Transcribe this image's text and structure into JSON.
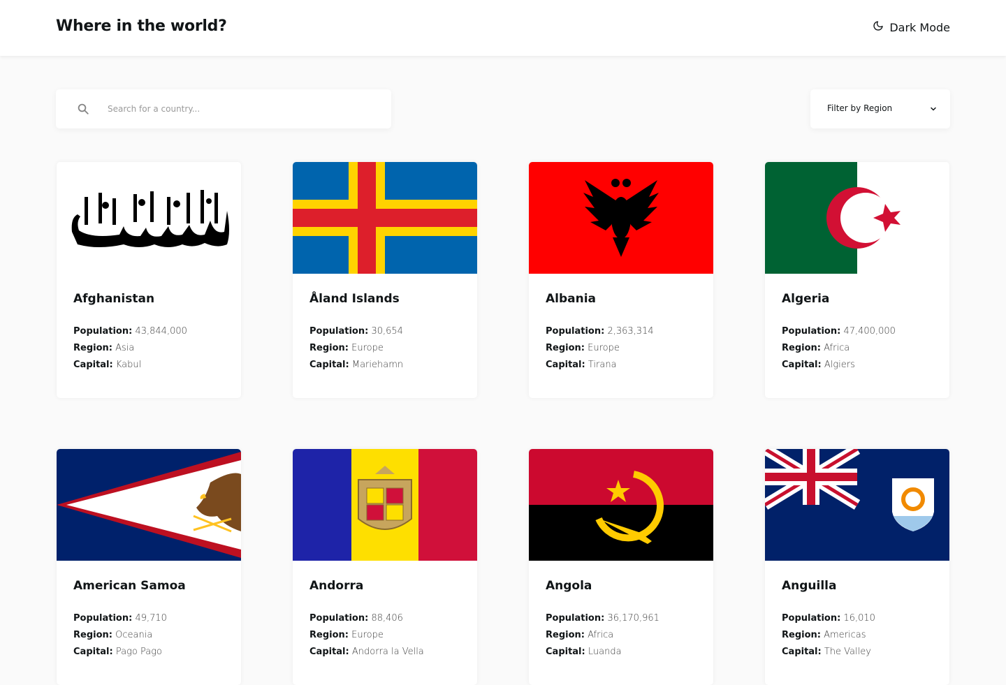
{
  "header": {
    "title": "Where in the world?",
    "dark_mode_label": "Dark Mode",
    "dark_mode_icon": "moon-icon"
  },
  "search": {
    "placeholder": "Search for a country...",
    "value": "",
    "icon": "search-icon"
  },
  "filter": {
    "label": "Filter by Region",
    "icon": "chevron-down-icon"
  },
  "labels": {
    "population": "Population:",
    "region": "Region:",
    "capital": "Capital:"
  },
  "countries": [
    {
      "name": "Afghanistan",
      "population": "43,844,000",
      "region": "Asia",
      "capital": "Kabul",
      "flag": "afghanistan-flag"
    },
    {
      "name": "Åland Islands",
      "population": "30,654",
      "region": "Europe",
      "capital": "Mariehamn",
      "flag": "aland-flag"
    },
    {
      "name": "Albania",
      "population": "2,363,314",
      "region": "Europe",
      "capital": "Tirana",
      "flag": "albania-flag"
    },
    {
      "name": "Algeria",
      "population": "47,400,000",
      "region": "Africa",
      "capital": "Algiers",
      "flag": "algeria-flag"
    },
    {
      "name": "American Samoa",
      "population": "49,710",
      "region": "Oceania",
      "capital": "Pago Pago",
      "flag": "american-samoa-flag"
    },
    {
      "name": "Andorra",
      "population": "88,406",
      "region": "Europe",
      "capital": "Andorra la Vella",
      "flag": "andorra-flag"
    },
    {
      "name": "Angola",
      "population": "36,170,961",
      "region": "Africa",
      "capital": "Luanda",
      "flag": "angola-flag"
    },
    {
      "name": "Anguilla",
      "population": "16,010",
      "region": "Americas",
      "capital": "The Valley",
      "flag": "anguilla-flag"
    }
  ]
}
